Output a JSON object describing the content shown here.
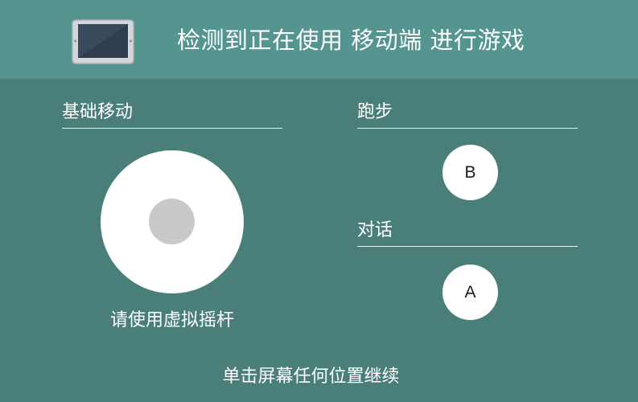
{
  "header": {
    "icon": "tablet-icon",
    "title": "检测到正在使用 移动端 进行游戏"
  },
  "controls": {
    "movement": {
      "label": "基础移动",
      "hint": "请使用虚拟摇杆",
      "icon": "joystick"
    },
    "run": {
      "label": "跑步",
      "button": "B"
    },
    "talk": {
      "label": "对话",
      "button": "A"
    }
  },
  "footer": {
    "hint": "单击屏幕任何位置继续"
  },
  "colors": {
    "background": "#4a7f79",
    "header_background": "#54958f",
    "button": "#ffffff",
    "joystick_knob": "#c9c9c9"
  }
}
